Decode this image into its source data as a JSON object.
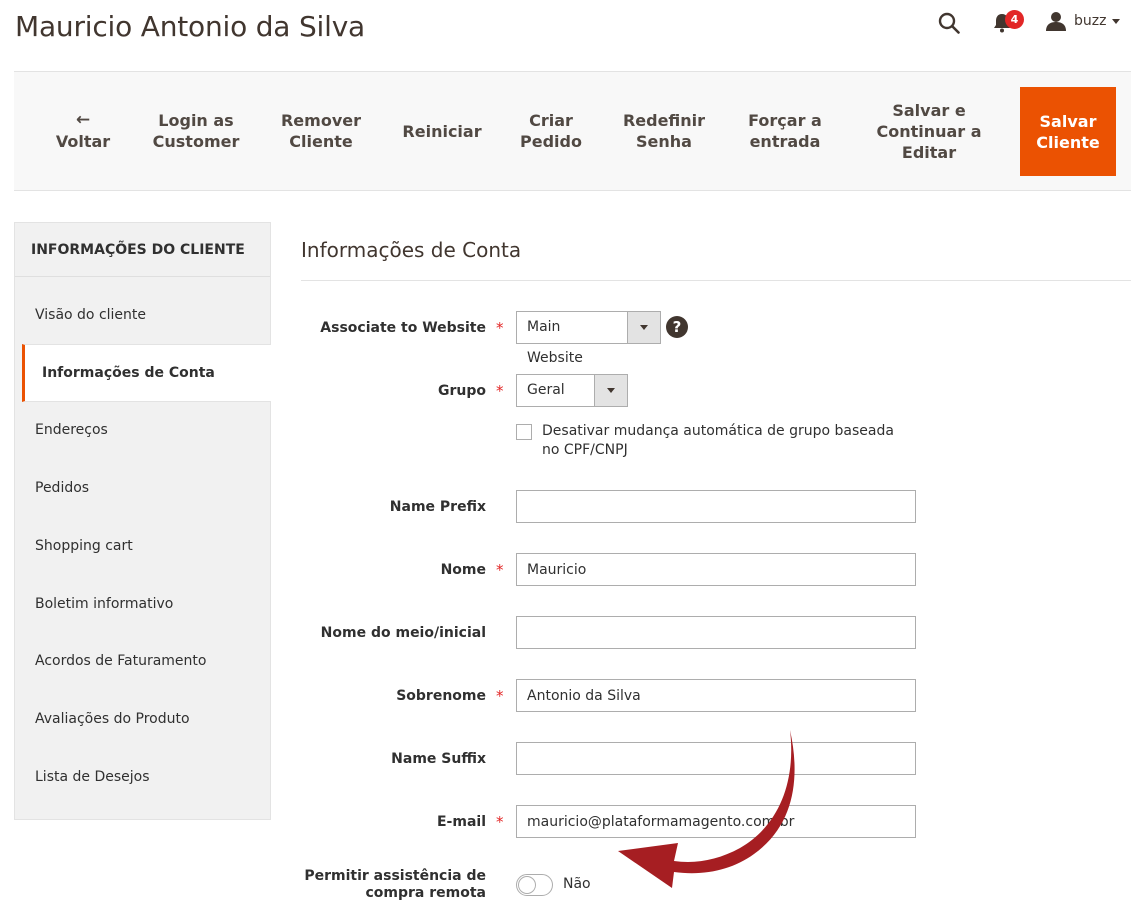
{
  "header": {
    "title": "Mauricio Antonio da Silva",
    "notification_count": "4",
    "username": "buzz",
    "icons": [
      "search-icon",
      "bell-icon",
      "user-icon"
    ]
  },
  "toolbar": {
    "back": "Voltar",
    "login_as_customer": "Login as Customer",
    "remove_customer": "Remover Cliente",
    "reset": "Reiniciar",
    "create_order": "Criar Pedido",
    "reset_password": "Redefinir Senha",
    "force_login": "Forçar a entrada",
    "save_continue": "Salvar e Continuar a Editar",
    "save_customer": "Salvar Cliente",
    "save_color": "#eb5202"
  },
  "sidebar": {
    "title": "INFORMAÇÕES DO CLIENTE",
    "items": [
      {
        "label": "Visão do cliente"
      },
      {
        "label": "Informações de Conta"
      },
      {
        "label": "Endereços"
      },
      {
        "label": "Pedidos"
      },
      {
        "label": "Shopping cart"
      },
      {
        "label": "Boletim informativo"
      },
      {
        "label": "Acordos de Faturamento"
      },
      {
        "label": "Avaliações do Produto"
      },
      {
        "label": "Lista de Desejos"
      }
    ],
    "active_index": 1
  },
  "form": {
    "section_title": "Informações de Conta",
    "website": {
      "label": "Associate to Website",
      "value": "Main Website"
    },
    "group": {
      "label": "Grupo",
      "value": "Geral"
    },
    "disable_auto_group": {
      "label": "Desativar mudança automática de grupo baseada no CPF/CNPJ",
      "checked": false
    },
    "name_prefix": {
      "label": "Name Prefix",
      "value": ""
    },
    "first_name": {
      "label": "Nome",
      "value": "Mauricio"
    },
    "middle_name": {
      "label": "Nome do meio/inicial",
      "value": ""
    },
    "last_name": {
      "label": "Sobrenome",
      "value": "Antonio da Silva"
    },
    "name_suffix": {
      "label": "Name Suffix",
      "value": ""
    },
    "email": {
      "label": "E-mail",
      "value": "mauricio@plataformamagento.com.br"
    },
    "remote_assistance": {
      "label": "Permitir assistência de compra remota",
      "value": "Não",
      "enabled": false
    },
    "required_mark": "*"
  },
  "annotation": {
    "color": "#a61e22",
    "icon": "curved-arrow-annotation"
  }
}
